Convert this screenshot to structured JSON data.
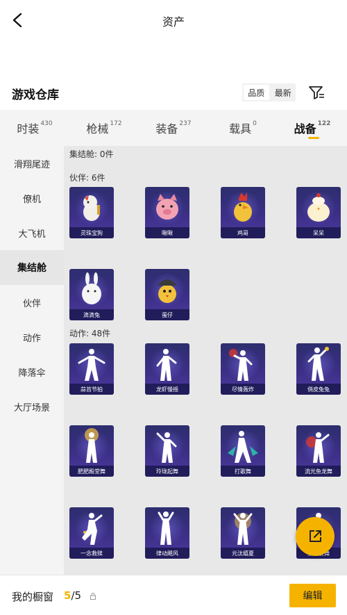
{
  "header": {
    "title": "资产"
  },
  "warehouse": {
    "title": "游戏仓库",
    "sort": [
      "品质",
      "最新"
    ],
    "sort_active": 0
  },
  "tabs": [
    {
      "label": "时装",
      "count": "430",
      "active": false
    },
    {
      "label": "枪械",
      "count": "172",
      "active": false
    },
    {
      "label": "装备",
      "count": "237",
      "active": false
    },
    {
      "label": "载具",
      "count": "0",
      "active": false
    },
    {
      "label": "战备",
      "count": "122",
      "active": true
    }
  ],
  "sidebar": {
    "items": [
      "滑翔尾迹",
      "僚机",
      "大飞机",
      "集结舱",
      "伙伴",
      "动作",
      "降落伞",
      "大厅场景"
    ],
    "active_index": 3
  },
  "sections": {
    "pod": {
      "label": "集结舱: 0件"
    },
    "partners": {
      "label": "伙伴: 6件",
      "items": [
        "灵珠宝狗",
        "啾啾",
        "鸡哥",
        "呆呆",
        "滴滴兔",
        "蛋仔"
      ]
    },
    "emotes": {
      "label": "动作: 48件",
      "items": [
        "蒜苔节拍",
        "龙虾慢摇",
        "尽情轰炸",
        "俏皮兔兔",
        "肥肥殿堂舞",
        "玲珑起舞",
        "打歌舞",
        "流光鱼龙舞",
        "一念救赎",
        "律动飓风",
        "元汰嬉夏",
        "星河旋舞"
      ]
    }
  },
  "bottom": {
    "showcase_label": "我的橱窗",
    "current": "5",
    "separator": "/",
    "max": "5",
    "edit_label": "编辑"
  },
  "icons": {
    "back": "chevron-left-icon",
    "filter": "filter-icon",
    "share": "share-external-icon",
    "lock": "lock-icon"
  },
  "colors": {
    "accent": "#f5b300",
    "card_bg": "#3c2f86"
  }
}
